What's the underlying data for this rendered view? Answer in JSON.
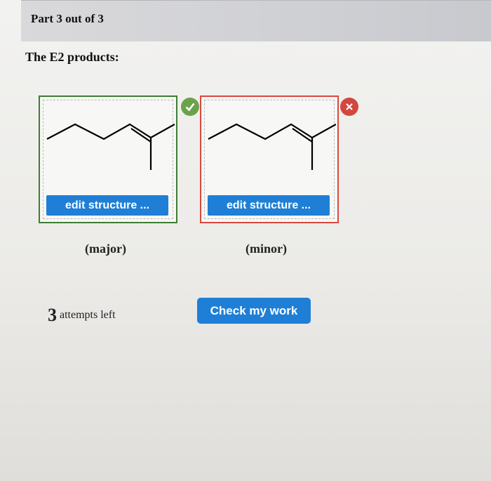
{
  "header": {
    "part_label": "Part 3 out of 3"
  },
  "prompt": "The E2 products:",
  "products": [
    {
      "caption": "(major)",
      "edit_label": "edit structure ...",
      "status": "correct",
      "status_icon": "check-icon",
      "border_color": "#3d7d34"
    },
    {
      "caption": "(minor)",
      "edit_label": "edit structure ...",
      "status": "incorrect",
      "status_icon": "x-icon",
      "border_color": "#d9493f"
    }
  ],
  "attempts": {
    "count": "3",
    "label": "attempts left"
  },
  "check_button": {
    "label": "Check my work"
  },
  "colors": {
    "accent": "#1f7fd6",
    "correct": "#6aa24a",
    "incorrect": "#d2473f"
  }
}
